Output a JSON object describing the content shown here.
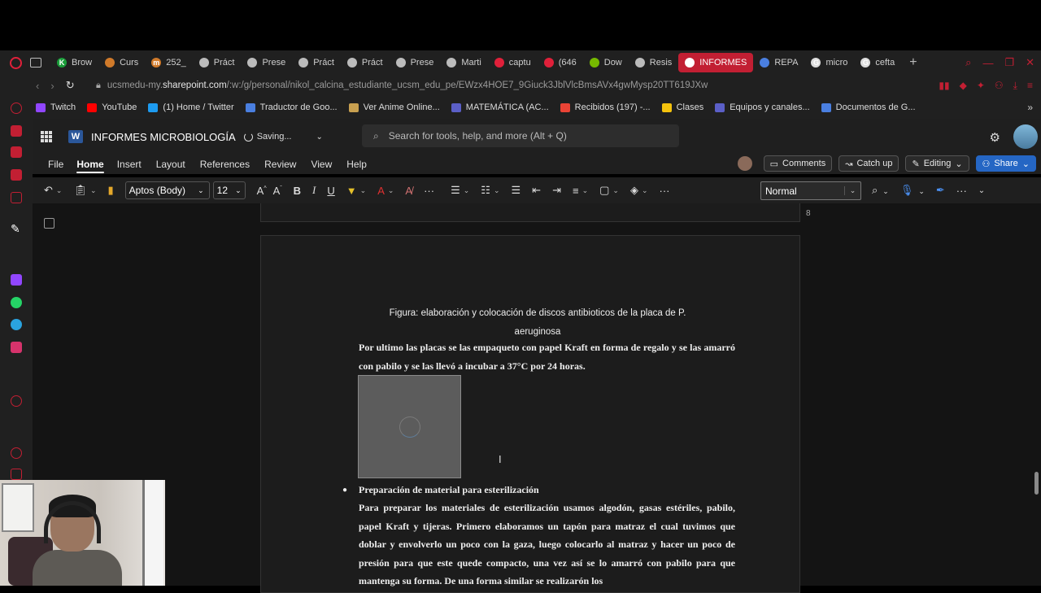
{
  "browser": {
    "tabs": [
      {
        "label": "Brow",
        "color": "#1a9d3a",
        "glyph": "K"
      },
      {
        "label": "Curs",
        "color": "#d07a2a",
        "glyph": ""
      },
      {
        "label": "252_",
        "color": "#d07a2a",
        "glyph": "m"
      },
      {
        "label": "Práct",
        "color": "#bbbbbb",
        "glyph": ""
      },
      {
        "label": "Prese",
        "color": "#bbbbbb",
        "glyph": ""
      },
      {
        "label": "Práct",
        "color": "#bbbbbb",
        "glyph": ""
      },
      {
        "label": "Práct",
        "color": "#bbbbbb",
        "glyph": ""
      },
      {
        "label": "Prese",
        "color": "#bbbbbb",
        "glyph": ""
      },
      {
        "label": "Marti",
        "color": "#bbbbbb",
        "glyph": ""
      },
      {
        "label": "captu",
        "color": "#e0203a",
        "glyph": ""
      },
      {
        "label": "(646",
        "color": "#e0203a",
        "glyph": ""
      },
      {
        "label": "Dow",
        "color": "#76b900",
        "glyph": ""
      },
      {
        "label": "Resis",
        "color": "#bbbbbb",
        "glyph": ""
      },
      {
        "label": "INFORMES",
        "color": "#ffffff",
        "glyph": "",
        "active": true
      },
      {
        "label": "REPA",
        "color": "#4a7fe0",
        "glyph": ""
      },
      {
        "label": "micro",
        "color": "#dddddd",
        "glyph": "G"
      },
      {
        "label": "cefta",
        "color": "#dddddd",
        "glyph": "G"
      }
    ],
    "url_prefix": "ucsmedu-my.",
    "url_host": "sharepoint.com",
    "url_path": "/:w:/g/personal/nikol_calcina_estudiante_ucsm_edu_pe/EWzx4HOE7_9Giuck3JblVlcBmsAVx4gwMysp20TT619JXw",
    "bookmarks": [
      {
        "label": "Twitch",
        "color": "#9146ff"
      },
      {
        "label": "YouTube",
        "color": "#ff0000"
      },
      {
        "label": "(1) Home / Twitter",
        "color": "#1d9bf0"
      },
      {
        "label": "Traductor de Goo...",
        "color": "#4a7fe0"
      },
      {
        "label": "Ver Anime Online...",
        "color": "#c8a050"
      },
      {
        "label": "MATEMÁTICA (AC...",
        "color": "#5b5fc7"
      },
      {
        "label": "Recibidos (197) -...",
        "color": "#ea4335"
      },
      {
        "label": "Clases",
        "color": "#f4c20d"
      },
      {
        "label": "Equipos y canales...",
        "color": "#5b5fc7"
      },
      {
        "label": "Documentos de G...",
        "color": "#4a7fe0"
      }
    ]
  },
  "word": {
    "doc_title": "INFORMES MICROBIOLOGÍA",
    "save_status": "Saving...",
    "search_placeholder": "Search for tools, help, and more (Alt + Q)",
    "menu": [
      "File",
      "Home",
      "Insert",
      "Layout",
      "References",
      "Review",
      "View",
      "Help"
    ],
    "active_menu": "Home",
    "comments_label": "Comments",
    "catchup_label": "Catch up",
    "editing_label": "Editing",
    "share_label": "Share",
    "font_name": "Aptos (Body)",
    "font_size": "12",
    "style_name": "Normal",
    "page_number": "8",
    "caption_line1": "Figura: elaboración y colocación de discos antibioticos de la placa de P.",
    "caption_line2": "aeruginosa",
    "para1": "Por ultimo las placas se las empaqueto con papel Kraft en forma de regalo y se las amarró con pabilo y se las llevó a incubar a 37°C por 24 horas.",
    "bullet_heading": "Preparación de material para esterilización",
    "para2": "Para preparar los materiales de esterilización usamos algodón, gasas estériles, pabilo, papel Kraft y tijeras. Primero elaboramos un tapón para matraz el cual tuvimos que doblar y envolverlo un poco con la gaza, luego colocarlo al matraz y hacer un poco de presión para que este quede compacto, una vez así se lo amarró con pabilo para que mantenga su forma. De una forma similar se realizarón los"
  }
}
